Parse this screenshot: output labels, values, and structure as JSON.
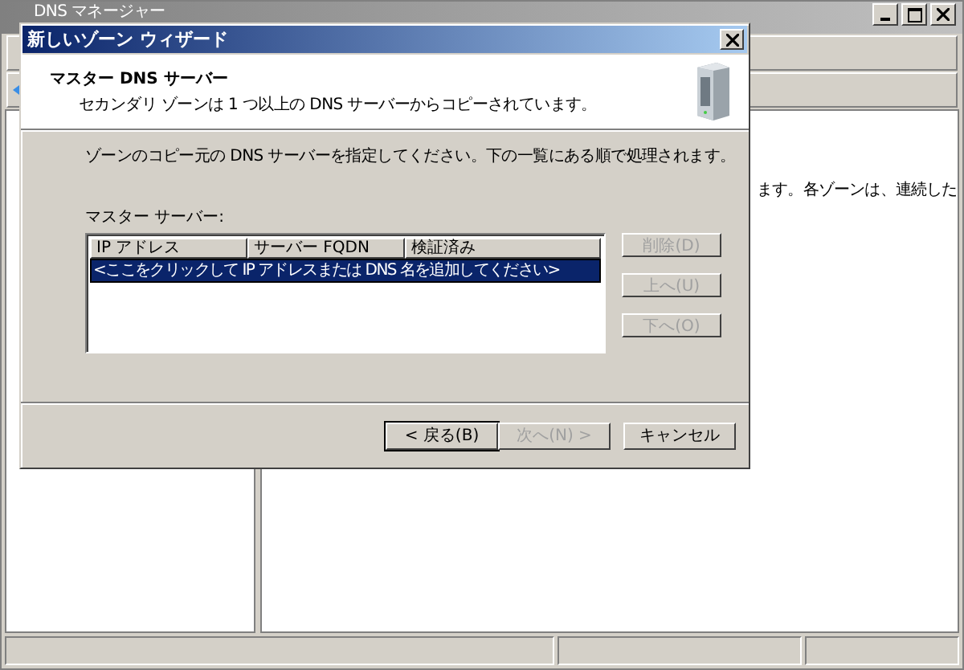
{
  "main_window": {
    "title": "DNS マネージャー",
    "right_pane_text": "ます。各ゾーンは、連続した"
  },
  "dialog": {
    "title": "新しいゾーン ウィザード",
    "heading": "マスター DNS サーバー",
    "subheading": "セカンダリ ゾーンは 1 つ以上の DNS サーバーからコピーされています。",
    "instruction": "ゾーンのコピー元の DNS サーバーを指定してください。下の一覧にある順で処理されます。",
    "list_label": "マスター サーバー:",
    "columns": [
      "IP アドレス",
      "サーバー FQDN",
      "検証済み"
    ],
    "rows": [
      {
        "text": "<ここをクリックして IP アドレスまたは DNS 名を追加してください>",
        "selected": true
      }
    ],
    "side_buttons": [
      {
        "label": "削除(D)",
        "disabled": true
      },
      {
        "label": "上へ(U)",
        "disabled": true
      },
      {
        "label": "下へ(O)",
        "disabled": true
      }
    ],
    "footer_buttons": [
      {
        "label": "< 戻る(B)",
        "disabled": false,
        "default": true
      },
      {
        "label": "次へ(N) >",
        "disabled": true,
        "default": false
      },
      {
        "label": "キャンセル",
        "disabled": false,
        "default": false
      }
    ]
  }
}
